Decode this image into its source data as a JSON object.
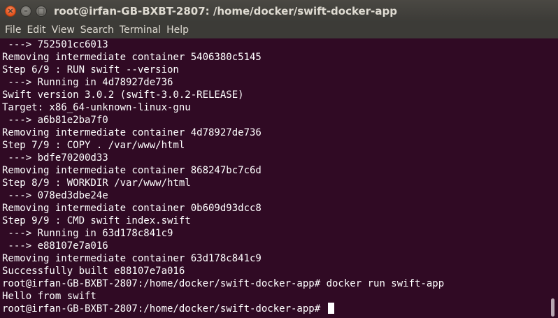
{
  "window": {
    "title": "root@irfan-GB-BXBT-2807: /home/docker/swift-docker-app",
    "close_glyph": "×",
    "minimize_glyph": "–",
    "maximize_glyph": "□"
  },
  "menu": {
    "items": [
      "File",
      "Edit",
      "View",
      "Search",
      "Terminal",
      "Help"
    ]
  },
  "terminal": {
    "lines": [
      " ---> 752501cc6013",
      "Removing intermediate container 5406380c5145",
      "Step 6/9 : RUN swift --version",
      " ---> Running in 4d78927de736",
      "Swift version 3.0.2 (swift-3.0.2-RELEASE)",
      "Target: x86_64-unknown-linux-gnu",
      " ---> a6b81e2ba7f0",
      "Removing intermediate container 4d78927de736",
      "Step 7/9 : COPY . /var/www/html",
      " ---> bdfe70200d33",
      "Removing intermediate container 868247bc7c6d",
      "Step 8/9 : WORKDIR /var/www/html",
      " ---> 078ed3dbe24e",
      "Removing intermediate container 0b609d93dcc8",
      "Step 9/9 : CMD swift index.swift",
      " ---> Running in 63d178c841c9",
      " ---> e88107e7a016",
      "Removing intermediate container 63d178c841c9",
      "Successfully built e88107e7a016",
      "root@irfan-GB-BXBT-2807:/home/docker/swift-docker-app# docker run swift-app",
      "Hello from swift"
    ],
    "prompt": "root@irfan-GB-BXBT-2807:/home/docker/swift-docker-app# "
  },
  "colors": {
    "terminal_background": "#300a24",
    "terminal_foreground": "#ffffff",
    "titlebar_background": "#3c3b37",
    "close_button": "#e3511b"
  }
}
